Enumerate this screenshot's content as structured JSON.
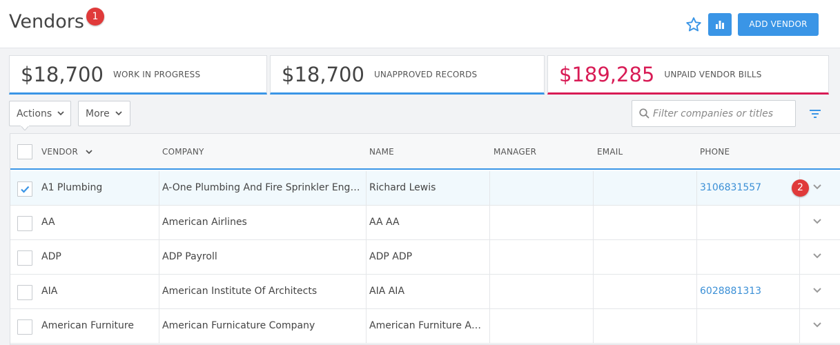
{
  "header": {
    "title": "Vendors",
    "title_badge": "1",
    "add_button": "ADD VENDOR",
    "icons": [
      "star-icon",
      "bar-chart-icon"
    ]
  },
  "summary": [
    {
      "amount": "$18,700",
      "label": "WORK IN PROGRESS"
    },
    {
      "amount": "$18,700",
      "label": "UNAPPROVED RECORDS"
    },
    {
      "amount": "$189,285",
      "label": "UNPAID VENDOR BILLS"
    }
  ],
  "toolbar": {
    "actions_label": "Actions",
    "more_label": "More",
    "search_placeholder": "Filter companies or titles"
  },
  "table": {
    "columns": [
      "VENDOR",
      "COMPANY",
      "NAME",
      "MANAGER",
      "EMAIL",
      "PHONE"
    ],
    "rows": [
      {
        "vendor": "A1 Plumbing",
        "company": "A-One Plumbing And Fire Sprinkler Engineering",
        "name": "Richard Lewis",
        "manager": "",
        "email": "",
        "phone": "3106831557",
        "selected": true,
        "badge": "2"
      },
      {
        "vendor": "AA",
        "company": "American Airlines",
        "name": "AA AA",
        "manager": "",
        "email": "",
        "phone": "",
        "selected": false
      },
      {
        "vendor": "ADP",
        "company": "ADP Payroll",
        "name": "ADP ADP",
        "manager": "",
        "email": "",
        "phone": "",
        "selected": false
      },
      {
        "vendor": "AIA",
        "company": "American Institute Of Architects",
        "name": "AIA AIA",
        "manager": "",
        "email": "",
        "phone": "6028881313",
        "selected": false
      },
      {
        "vendor": "American Furniture",
        "company": "American Furnicature Company",
        "name": "American Furniture Americ…",
        "manager": "",
        "email": "",
        "phone": "",
        "selected": false
      }
    ]
  },
  "colors": {
    "accent": "#3a95e6",
    "alert": "#d81b55",
    "badge": "#e03a3a",
    "link": "#3a8fd6"
  }
}
